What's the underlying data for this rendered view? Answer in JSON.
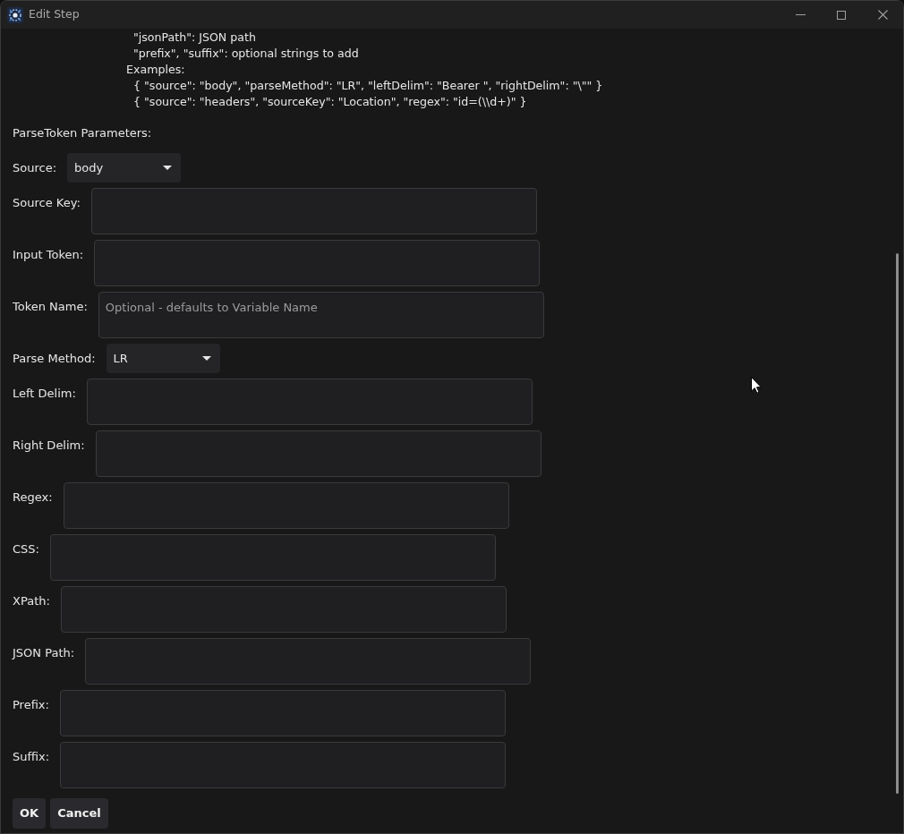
{
  "window": {
    "title": "Edit Step"
  },
  "help_lines": [
    "  \"jsonPath\": JSON path",
    "  \"prefix\", \"suffix\": optional strings to add",
    "Examples:",
    "  { \"source\": \"body\", \"parseMethod\": \"LR\", \"leftDelim\": \"Bearer \", \"rightDelim\": \"\\\"\" }",
    "  { \"source\": \"headers\", \"sourceKey\": \"Location\", \"regex\": \"id=(\\\\d+)\" }"
  ],
  "section_title": "ParseToken Parameters:",
  "fields": [
    {
      "kind": "select",
      "label": "Source:",
      "value": "body"
    },
    {
      "kind": "text",
      "label": "Source Key:"
    },
    {
      "kind": "text",
      "label": "Input Token:"
    },
    {
      "kind": "text",
      "label": "Token Name:",
      "placeholder": "Optional - defaults to Variable Name"
    },
    {
      "kind": "select",
      "label": "Parse Method:",
      "value": "LR"
    },
    {
      "kind": "text",
      "label": "Left Delim:"
    },
    {
      "kind": "text",
      "label": "Right Delim:"
    },
    {
      "kind": "text",
      "label": "Regex:"
    },
    {
      "kind": "text",
      "label": "CSS:"
    },
    {
      "kind": "text",
      "label": "XPath:"
    },
    {
      "kind": "text",
      "label": "JSON Path:"
    },
    {
      "kind": "text",
      "label": "Prefix:"
    },
    {
      "kind": "text",
      "label": "Suffix:"
    }
  ],
  "buttons": [
    "OK",
    "Cancel"
  ]
}
